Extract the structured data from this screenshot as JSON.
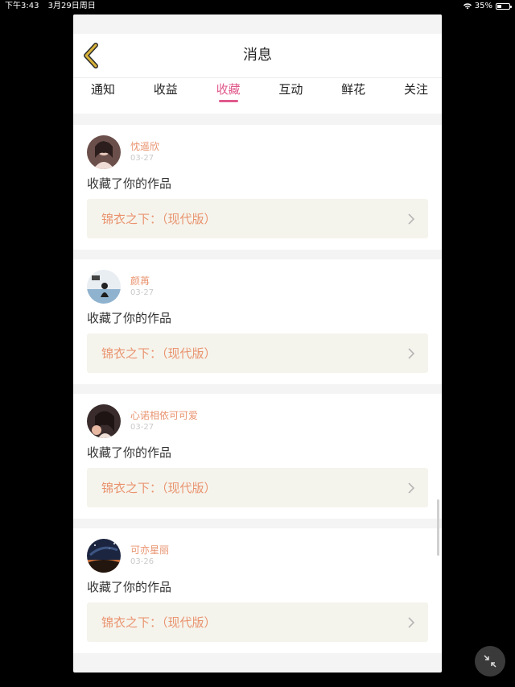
{
  "status_bar": {
    "time": "下午3:43",
    "date": "3月29日周日",
    "battery": "35%",
    "battery_level": 0.35
  },
  "header": {
    "back_icon": "chevron-left-icon",
    "title": "消息"
  },
  "tabs": [
    {
      "label": "通知",
      "active": false
    },
    {
      "label": "收益",
      "active": false
    },
    {
      "label": "收藏",
      "active": true
    },
    {
      "label": "互动",
      "active": false
    },
    {
      "label": "鲜花",
      "active": false
    },
    {
      "label": "关注",
      "active": false
    }
  ],
  "items": [
    {
      "username": "忱遥欣",
      "date": "03-27",
      "action": "收藏了你的作品",
      "work": "锦衣之下：（现代版）"
    },
    {
      "username": "颜苒",
      "date": "03-27",
      "action": "收藏了你的作品",
      "work": "锦衣之下：（现代版）"
    },
    {
      "username": "心诺相依可可爱",
      "date": "03-27",
      "action": "收藏了你的作品",
      "work": "锦衣之下：（现代版）"
    },
    {
      "username": "可亦星丽",
      "date": "03-26",
      "action": "收藏了你的作品",
      "work": "锦衣之下：（现代版）"
    }
  ],
  "colors": {
    "accent_pink": "#e05a8c",
    "username_orange": "#e9936f",
    "back_icon_yellow": "#c9a227"
  }
}
